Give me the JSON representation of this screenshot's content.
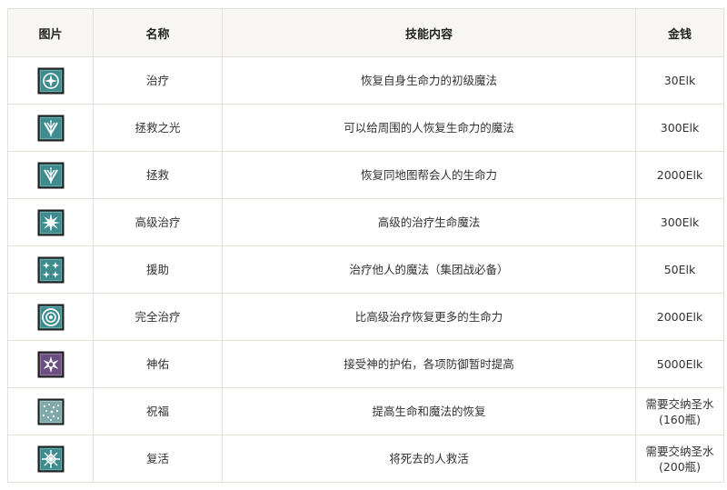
{
  "table": {
    "headers": {
      "image": "图片",
      "name": "名称",
      "desc": "技能内容",
      "cost": "金钱"
    },
    "rows": [
      {
        "icon": "compass-star-icon",
        "name": "治疗",
        "desc": "恢复自身生命力的初级魔法",
        "cost": "30Elk",
        "color": "#3f8c8f"
      },
      {
        "icon": "chevron-cross-icon",
        "name": "拯救之光",
        "desc": "可以给周围的人恢复生命力的魔法",
        "cost": "300Elk",
        "color": "#3f8c8f"
      },
      {
        "icon": "chevron-cross-icon",
        "name": "拯救",
        "desc": "恢复同地图帮会人的生命力",
        "cost": "2000Elk",
        "color": "#3f8c8f"
      },
      {
        "icon": "starburst-icon",
        "name": "高级治疗",
        "desc": "高级的治疗生命魔法",
        "cost": "300Elk",
        "color": "#3f8c8f"
      },
      {
        "icon": "four-sparkles-icon",
        "name": "援助",
        "desc": "治疗他人的魔法（集团战必备）",
        "cost": "50Elk",
        "color": "#3f8c8f"
      },
      {
        "icon": "concentric-rings-icon",
        "name": "完全治疗",
        "desc": "比高级治疗恢复更多的生命力",
        "cost": "2000Elk",
        "color": "#3f8c8f"
      },
      {
        "icon": "divine-star-icon",
        "name": "神佑",
        "desc": "接受神的护佑，各项防御暂时提高",
        "cost": "5000Elk",
        "color": "#6a4f80"
      },
      {
        "icon": "blessing-sparkle-icon",
        "name": "祝福",
        "desc": "提高生命和魔法的恢复",
        "cost": "需要交纳圣水\n(160瓶)",
        "color": "#7fa8a8"
      },
      {
        "icon": "revive-burst-icon",
        "name": "复活",
        "desc": "将死去的人救活",
        "cost": "需要交纳圣水\n(200瓶)",
        "color": "#3f8c8f"
      }
    ]
  }
}
